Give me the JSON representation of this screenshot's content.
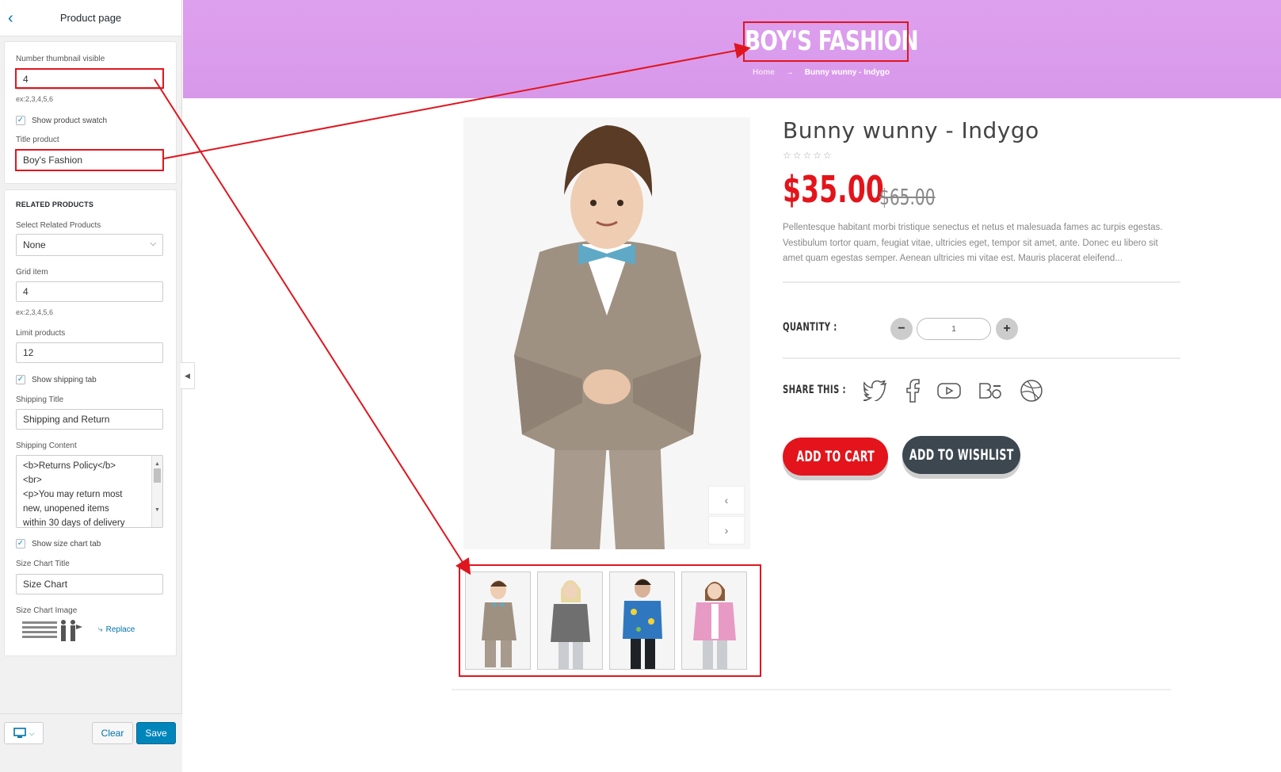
{
  "sidebar": {
    "header_title": "Product page",
    "thumb_visible": {
      "label": "Number thumbnail visible",
      "value": "4",
      "hint": "ex:2,3,4,5,6"
    },
    "show_swatch": {
      "label": "Show product swatch",
      "checked": true
    },
    "title_product": {
      "label": "Title product",
      "value": "Boy's Fashion"
    },
    "related": {
      "heading": "RELATED PRODUCTS",
      "select_label": "Select Related Products",
      "select_value": "None",
      "grid_label": "Grid item",
      "grid_value": "4",
      "grid_hint": "ex:2,3,4,5,6",
      "limit_label": "Limit products",
      "limit_value": "12"
    },
    "shipping": {
      "show_label": "Show shipping tab",
      "title_label": "Shipping Title",
      "title_value": "Shipping and Return",
      "content_label": "Shipping Content",
      "content_lines": [
        "<b>Returns Policy</b>",
        "<br>",
        "<p>You may return most",
        "new, unopened items",
        "within 30 days of delivery"
      ]
    },
    "size_chart": {
      "show_label": "Show size chart tab",
      "title_label": "Size Chart Title",
      "title_value": "Size Chart",
      "image_label": "Size Chart Image",
      "replace_label": "Replace"
    },
    "footer": {
      "clear_label": "Clear",
      "save_label": "Save"
    }
  },
  "preview": {
    "banner_title": "BOY'S FASHION",
    "breadcrumb": {
      "home": "Home",
      "arrow": "→",
      "current": "Bunny wunny - Indygo"
    },
    "product": {
      "title": "Bunny wunny - Indygo",
      "stars": "☆☆☆☆☆",
      "price": "$35.00",
      "old_price": "$65.00",
      "description": "Pellentesque habitant morbi tristique senectus et netus et malesuada fames ac turpis egestas. Vestibulum tortor quam, feugiat vitae, ultricies eget, tempor sit amet, ante. Donec eu libero sit amet quam egestas semper. Aenean ultricies mi vitae est. Mauris placerat eleifend...",
      "quantity_label": "QUANTITY :",
      "quantity_value": "1",
      "share_label": "SHARE THIS :",
      "share_icons": [
        "twitter-icon",
        "facebook-icon",
        "youtube-icon",
        "behance-icon",
        "dribbble-icon"
      ],
      "add_to_cart": "ADD TO CART",
      "add_to_wishlist": "ADD TO WISHLIST"
    },
    "thumbnails": [
      "boy-grey-suit",
      "girl-grey-jacket",
      "boy-blue-jacket",
      "girl-pink-jacket"
    ]
  },
  "colors": {
    "accent": "#0085ba",
    "brand_red": "#e3141b",
    "banner": "#dda0ee",
    "annotation": "#e0161f"
  }
}
